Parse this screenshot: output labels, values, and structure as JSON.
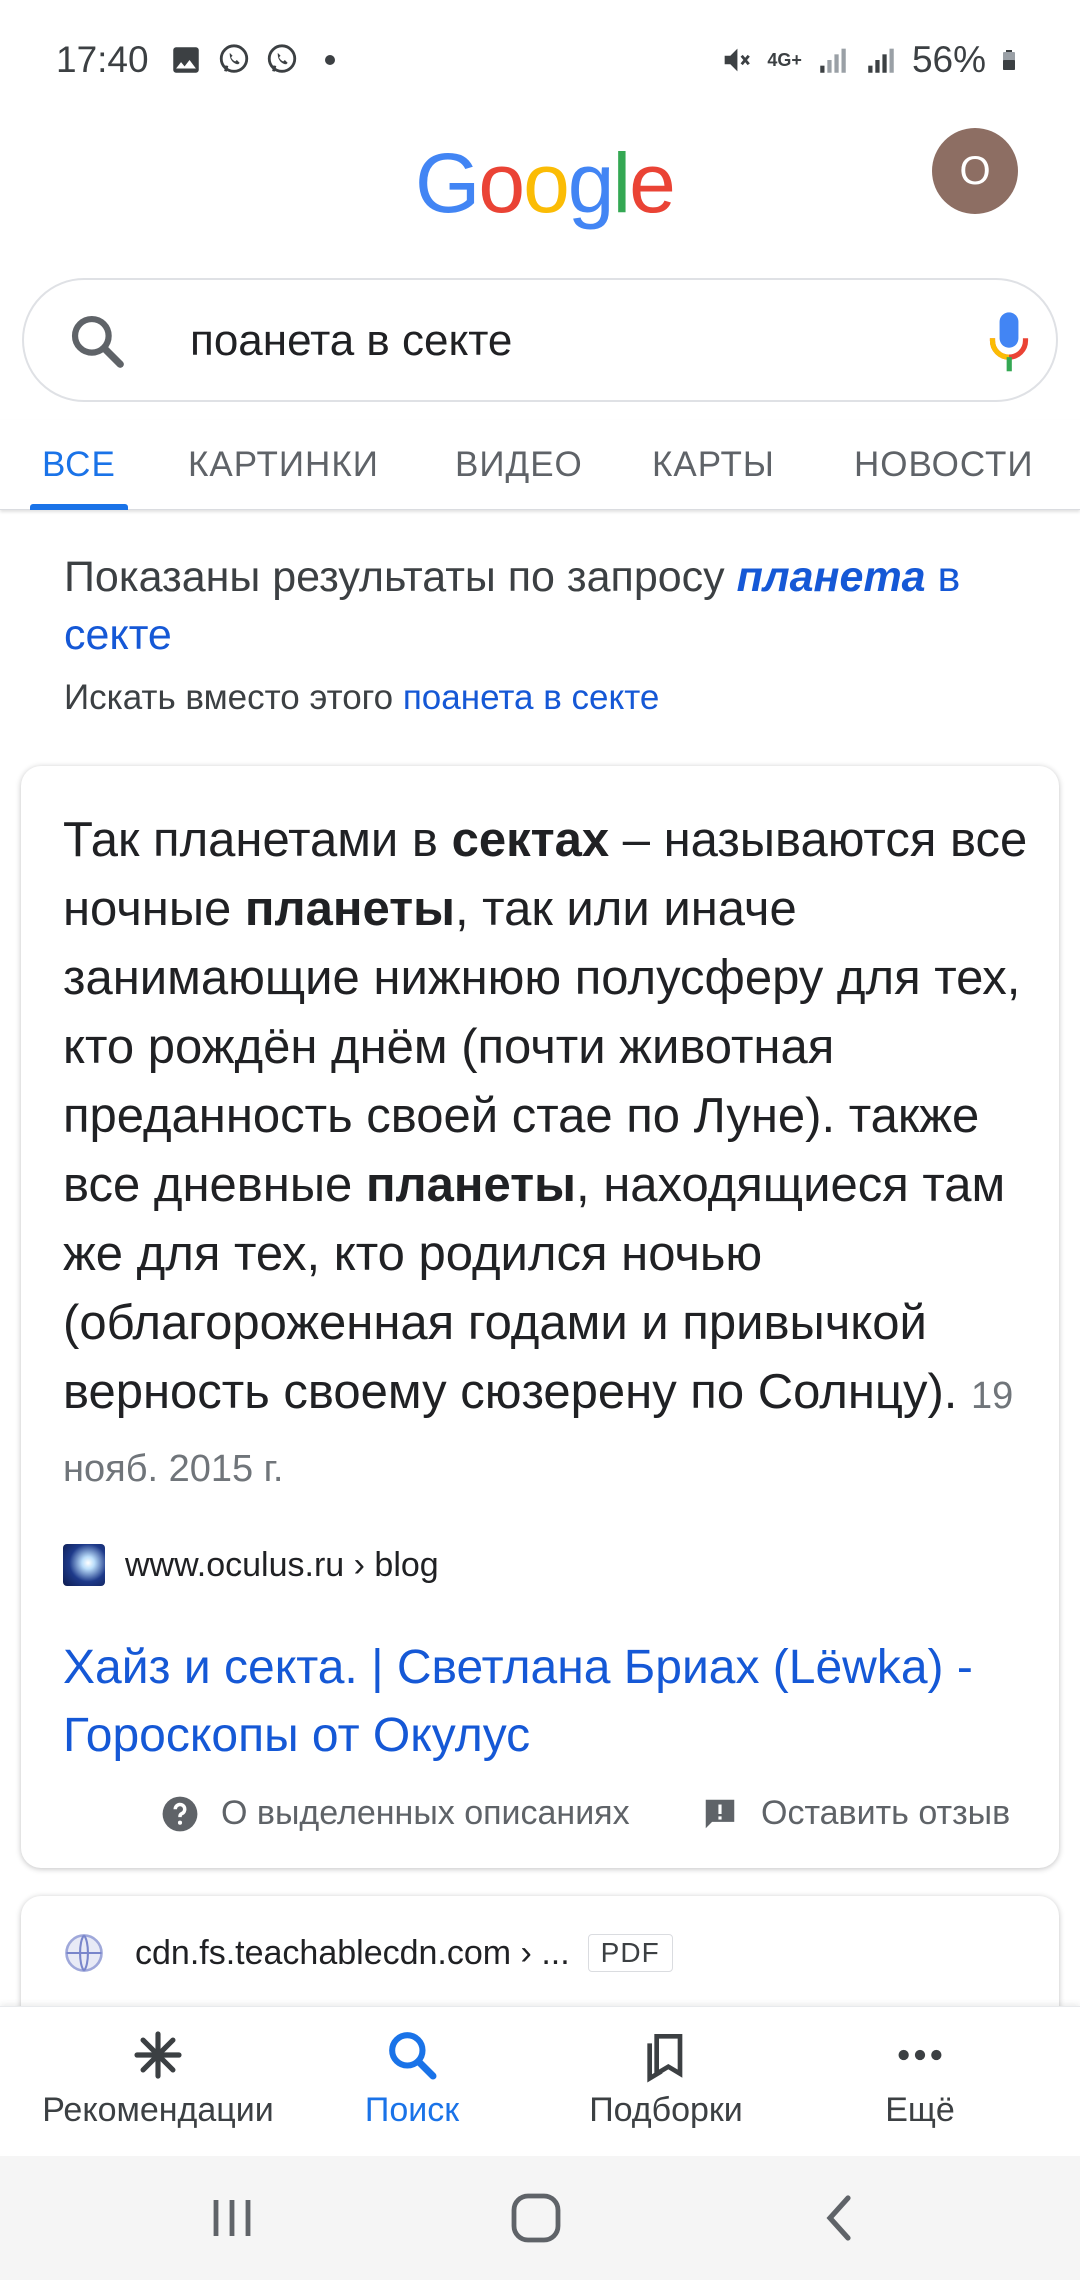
{
  "status_bar": {
    "time": "17:40",
    "network": "4G+",
    "battery": "56%",
    "icons": [
      "image-icon",
      "viber-icon",
      "viber-icon",
      "mute-icon",
      "signal-icon",
      "battery-icon"
    ]
  },
  "header": {
    "logo_letters": [
      "G",
      "o",
      "o",
      "g",
      "l",
      "e"
    ],
    "logo_colors": [
      "#4285F4",
      "#EA4335",
      "#FBBC05",
      "#4285F4",
      "#34A853",
      "#EA4335"
    ],
    "avatar_letter": "O",
    "avatar_color": "#8d6e63"
  },
  "search": {
    "query": "поанета в секте"
  },
  "tabs": [
    {
      "label": "ВСЕ",
      "active": true
    },
    {
      "label": "КАРТИНКИ",
      "active": false
    },
    {
      "label": "ВИДЕО",
      "active": false
    },
    {
      "label": "КАРТЫ",
      "active": false
    },
    {
      "label": "НОВОСТИ",
      "active": false
    }
  ],
  "correction": {
    "prefix": "Показаны результаты по запросу ",
    "corrected_bold": "планета",
    "corrected_rest": " в секте",
    "instead_prefix": "Искать вместо этого ",
    "original_query": "поанета в секте"
  },
  "featured": {
    "s1": "Так планетами в ",
    "b1": "сектах",
    "s2": " – называются все ночные ",
    "b2": "планеты",
    "s3": ", так или иначе занимающие нижнюю полусферу для тех, кто рождён днём (почти животная преданность своей стае по Луне). также все дневные ",
    "b3": "планеты",
    "s4": ", находящиеся там же для тех, кто родился ночью (облагороженная годами и привычкой верность своему сюзерену по Солнцу).",
    "date": "19 нояб. 2015 г.",
    "source": "www.oculus.ru › blog",
    "title": "Хайз и секта. | Светлана Бриах (Lëwka) - Гороскопы от Окулус",
    "about_label": "О выделенных описаниях",
    "feedback_label": "Оставить отзыв"
  },
  "second_result": {
    "source": "cdn.fs.teachablecdn.com › ...",
    "badge": "PDF"
  },
  "bottom_nav": [
    {
      "label": "Рекомендации",
      "icon": "asterisk-icon",
      "active": false
    },
    {
      "label": "Поиск",
      "icon": "search-icon",
      "active": true
    },
    {
      "label": "Подборки",
      "icon": "collections-icon",
      "active": false
    },
    {
      "label": "Ещё",
      "icon": "more-icon",
      "active": false
    }
  ],
  "colors": {
    "accent": "#1a73e8",
    "link": "#1558d6"
  }
}
